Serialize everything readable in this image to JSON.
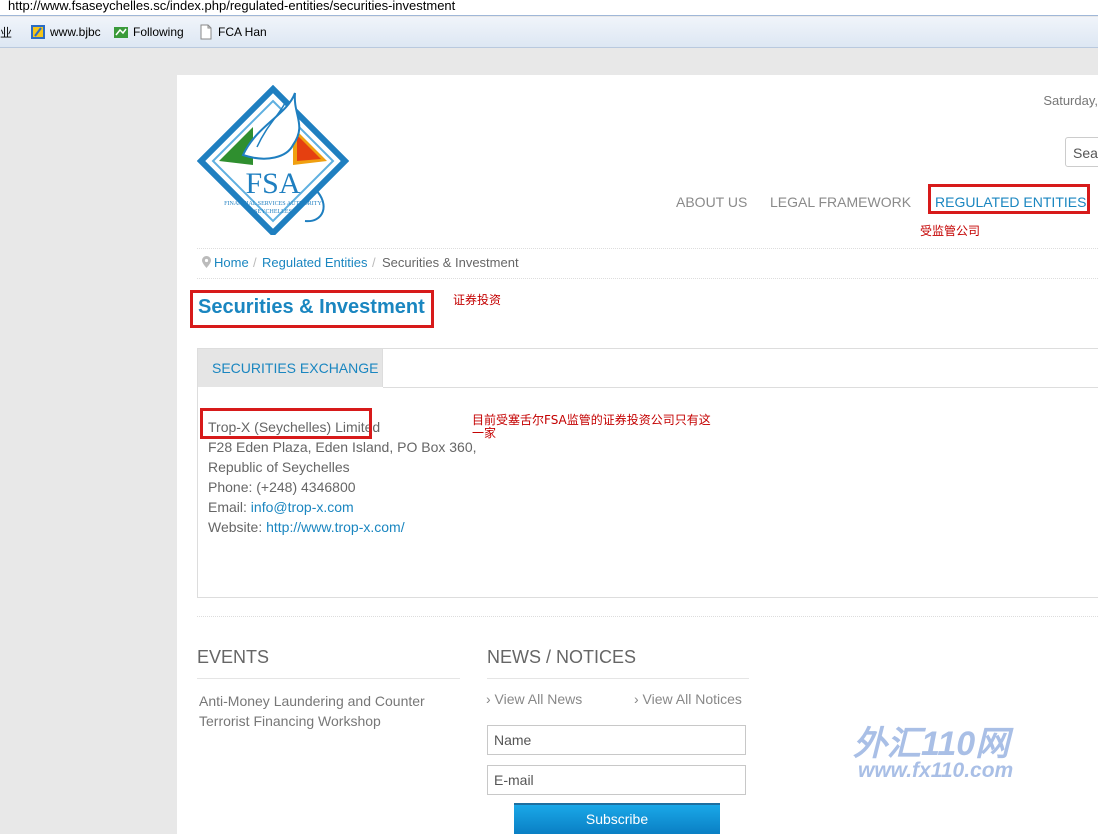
{
  "browser": {
    "url": "http://www.fsaseychelles.sc/index.php/regulated-entities/securities-investment",
    "bookmarks": [
      {
        "label": "企业"
      },
      {
        "label": "www.bjbc"
      },
      {
        "label": "Following"
      },
      {
        "label": "FCA Han"
      }
    ]
  },
  "header": {
    "logo": {
      "acronym": "FSA",
      "line1": "FINANCIAL SERVICES AUTHORITY",
      "line2": "SEYCHELLES"
    },
    "date": "Saturday,",
    "search_placeholder": "Sea"
  },
  "nav": {
    "items": [
      {
        "label": "ABOUT US"
      },
      {
        "label": "LEGAL FRAMEWORK"
      },
      {
        "label": "REGULATED ENTITIES"
      }
    ]
  },
  "breadcrumb": {
    "items": [
      "Home",
      "Regulated Entities",
      "Securities & Investment"
    ],
    "separator": "/"
  },
  "page": {
    "title": "Securities & Investment"
  },
  "tabs": [
    {
      "label": "SECURITIES EXCHANGE"
    }
  ],
  "entity": {
    "name": "Trop-X (Seychelles) Limited",
    "address1": "F28 Eden Plaza, Eden Island, PO Box 360,",
    "address2": "Republic of Seychelles",
    "phone": "Phone: (+248) 4346800",
    "email_label": "Email:",
    "email": "info@trop-x.com",
    "website_label": "Website:",
    "website": "http://www.trop-x.com/"
  },
  "events": {
    "heading": "EVENTS",
    "items": [
      "Anti-Money Laundering and Counter",
      "Terrorist Financing Workshop"
    ]
  },
  "news": {
    "heading": "NEWS / NOTICES",
    "view_news": "› View All News",
    "view_notices": "› View All Notices",
    "name_placeholder": "Name",
    "email_placeholder": "E-mail",
    "subscribe_label": "Subscribe"
  },
  "annotations": {
    "nav_note": "受监管公司",
    "title_note": "证券投资",
    "entity_note_line1": "目前受塞舌尔FSA监管的证券投资公司只有这",
    "entity_note_line2": "一家"
  },
  "watermark": {
    "brand": "外汇110网",
    "url": "www.fx110.com"
  },
  "colors": {
    "accent": "#1a86c0",
    "annotation_red": "#d71a1a",
    "button": "#0a8fd6"
  }
}
